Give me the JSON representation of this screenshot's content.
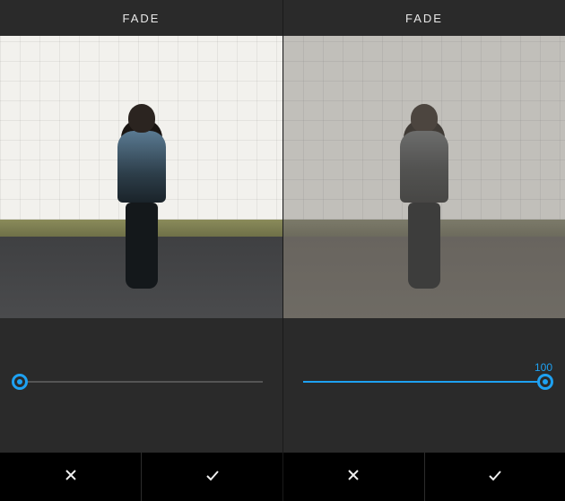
{
  "panels": [
    {
      "title": "FADE",
      "slider": {
        "value": 0,
        "max": 100,
        "show_label": false
      },
      "faded": false
    },
    {
      "title": "FADE",
      "slider": {
        "value": 100,
        "max": 100,
        "show_label": true
      },
      "faded": true
    }
  ],
  "colors": {
    "accent": "#1ea1f2"
  }
}
